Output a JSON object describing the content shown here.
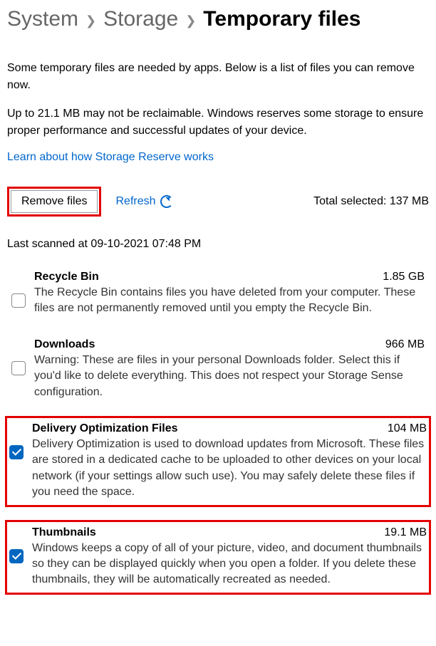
{
  "breadcrumb": {
    "level1": "System",
    "level2": "Storage",
    "current": "Temporary files"
  },
  "intro": {
    "para1": "Some temporary files are needed by apps. Below is a list of files you can remove now.",
    "para2": "Up to 21.1 MB may not be reclaimable. Windows reserves some storage to ensure proper performance and successful updates of your device."
  },
  "storage_reserve_link": "Learn about how Storage Reserve works",
  "actions": {
    "remove_label": "Remove files",
    "refresh_label": "Refresh",
    "total_selected_label": "Total selected:",
    "total_selected_value": "137 MB"
  },
  "last_scanned": "Last scanned at 09-10-2021 07:48 PM",
  "items": [
    {
      "title": "Recycle Bin",
      "size": "1.85 GB",
      "desc": "The Recycle Bin contains files you have deleted from your computer. These files are not permanently removed until you empty the Recycle Bin.",
      "checked": false,
      "highlighted": false
    },
    {
      "title": "Downloads",
      "size": "966 MB",
      "desc": "Warning: These are files in your personal Downloads folder. Select this if you'd like to delete everything. This does not respect your Storage Sense configuration.",
      "checked": false,
      "highlighted": false
    },
    {
      "title": "Delivery Optimization Files",
      "size": "104 MB",
      "desc": "Delivery Optimization is used to download updates from Microsoft. These files are stored in a dedicated cache to be uploaded to other devices on your local network (if your settings allow such use). You may safely delete these files if you need the space.",
      "checked": true,
      "highlighted": true
    },
    {
      "title": "Thumbnails",
      "size": "19.1 MB",
      "desc": "Windows keeps a copy of all of your picture, video, and document thumbnails so they can be displayed quickly when you open a folder. If you delete these thumbnails, they will be automatically recreated as needed.",
      "checked": true,
      "highlighted": true
    }
  ]
}
